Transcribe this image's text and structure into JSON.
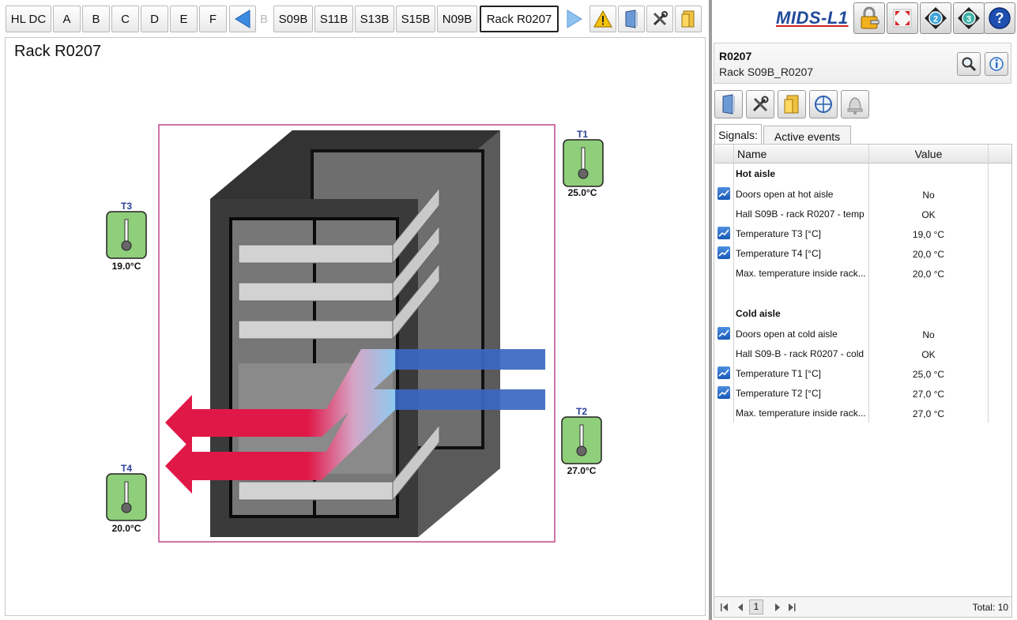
{
  "nav": {
    "buttons": [
      "HL DC",
      "A",
      "B",
      "C",
      "D",
      "E",
      "F"
    ],
    "partial_label": "B",
    "sections": [
      "S09B",
      "S11B",
      "S13B",
      "S15B",
      "N09B"
    ],
    "active": "Rack R0207",
    "icons": [
      "prev-arrow-icon",
      "next-arrow-icon",
      "warning-icon",
      "door-icon",
      "tools-icon",
      "cabinet-icon"
    ]
  },
  "logo": "MIDS-L1",
  "top_icons": [
    "lock-icon",
    "fullscreen-icon",
    "level2-icon",
    "level3-icon",
    "help-icon"
  ],
  "main": {
    "title": "Rack R0207",
    "sensors": [
      {
        "id": "T1",
        "value": "25.0°C"
      },
      {
        "id": "T2",
        "value": "27.0°C"
      },
      {
        "id": "T3",
        "value": "19.0°C"
      },
      {
        "id": "T4",
        "value": "20.0°C"
      }
    ],
    "colors": {
      "hot_flow": "#e01848",
      "cold_flow": "#3b67c0",
      "sensor_bg": "#8fce7a",
      "frame": "#c0478c"
    }
  },
  "info": {
    "id": "R0207",
    "subtitle": "Rack S09B_R0207"
  },
  "toolbar_icons": [
    "door-icon",
    "tools-icon",
    "cabinet-icon",
    "crosshair-icon",
    "bell-icon"
  ],
  "tabs": [
    "Signals:",
    "Active events"
  ],
  "grid": {
    "columns": [
      "Name",
      "Value"
    ],
    "rows": [
      {
        "type": "group",
        "name": "Hot aisle",
        "value": ""
      },
      {
        "type": "signal",
        "trend": true,
        "name": "Doors open at hot aisle",
        "value": "No"
      },
      {
        "type": "signal",
        "trend": false,
        "name": "Hall S09B - rack R0207 - temp",
        "value": "OK"
      },
      {
        "type": "signal",
        "trend": true,
        "name": "Temperature T3 [°C]",
        "value": "19,0 °C"
      },
      {
        "type": "signal",
        "trend": true,
        "name": "Temperature T4 [°C]",
        "value": "20,0 °C"
      },
      {
        "type": "signal",
        "trend": false,
        "name": "Max. temperature inside rack...",
        "value": "20,0 °C"
      },
      {
        "type": "spacer",
        "name": "",
        "value": ""
      },
      {
        "type": "group",
        "name": "Cold aisle",
        "value": ""
      },
      {
        "type": "signal",
        "trend": true,
        "name": "Doors open at cold aisle",
        "value": "No"
      },
      {
        "type": "signal",
        "trend": false,
        "name": "Hall S09-B - rack R0207 - cold",
        "value": "OK"
      },
      {
        "type": "signal",
        "trend": true,
        "name": "Temperature T1 [°C]",
        "value": "25,0 °C"
      },
      {
        "type": "signal",
        "trend": true,
        "name": "Temperature T2 [°C]",
        "value": "27,0 °C"
      },
      {
        "type": "signal",
        "trend": false,
        "name": "Max. temperature inside rack...",
        "value": "27,0 °C"
      }
    ],
    "pager": {
      "page": "1",
      "total_label": "Total: 10"
    }
  }
}
